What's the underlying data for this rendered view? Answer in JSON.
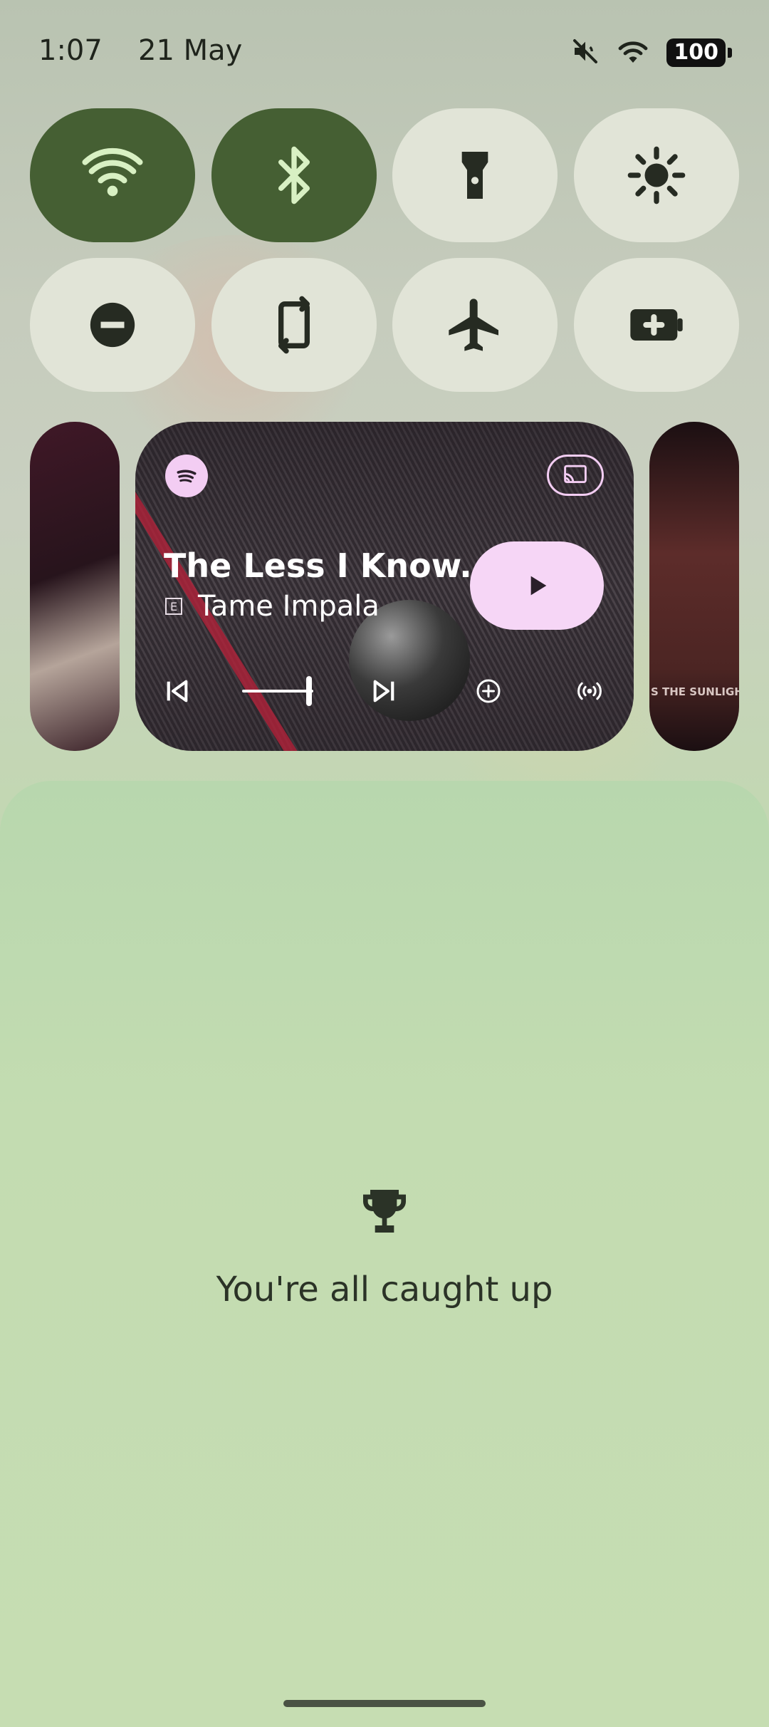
{
  "status_bar": {
    "time": "1:07",
    "date": "21 May",
    "battery_level": "100",
    "icons": [
      "mute-icon",
      "wifi-icon",
      "battery-icon"
    ]
  },
  "quick_settings": {
    "tiles": [
      {
        "name": "wifi",
        "icon": "wifi-icon",
        "active": true
      },
      {
        "name": "bluetooth",
        "icon": "bluetooth-icon",
        "active": true
      },
      {
        "name": "flashlight",
        "icon": "flashlight-icon",
        "active": false
      },
      {
        "name": "brightness",
        "icon": "brightness-icon",
        "active": false
      },
      {
        "name": "do-not-disturb",
        "icon": "dnd-icon",
        "active": false
      },
      {
        "name": "auto-rotate",
        "icon": "rotate-icon",
        "active": false
      },
      {
        "name": "airplane-mode",
        "icon": "airplane-icon",
        "active": false
      },
      {
        "name": "battery-saver",
        "icon": "battery-saver-icon",
        "active": false
      }
    ]
  },
  "media": {
    "app_icon": "spotify-icon",
    "song_title": "The Less I Know...",
    "explicit_badge": "E",
    "artist": "Tame Impala",
    "right_card_fragment": "S THE SUNLIGHT",
    "progress": 0.0,
    "controls": [
      "previous-icon",
      "next-icon",
      "add-icon",
      "broadcast-icon",
      "play-icon",
      "cast-icon"
    ]
  },
  "notifications": {
    "empty_message": "You're all caught up",
    "icon": "trophy-icon"
  },
  "colors": {
    "tile_active": "#455f33",
    "tile_inactive": "#e1e4d7",
    "play_button": "#f6d6f6",
    "accent_pink": "#f3cdf3"
  }
}
